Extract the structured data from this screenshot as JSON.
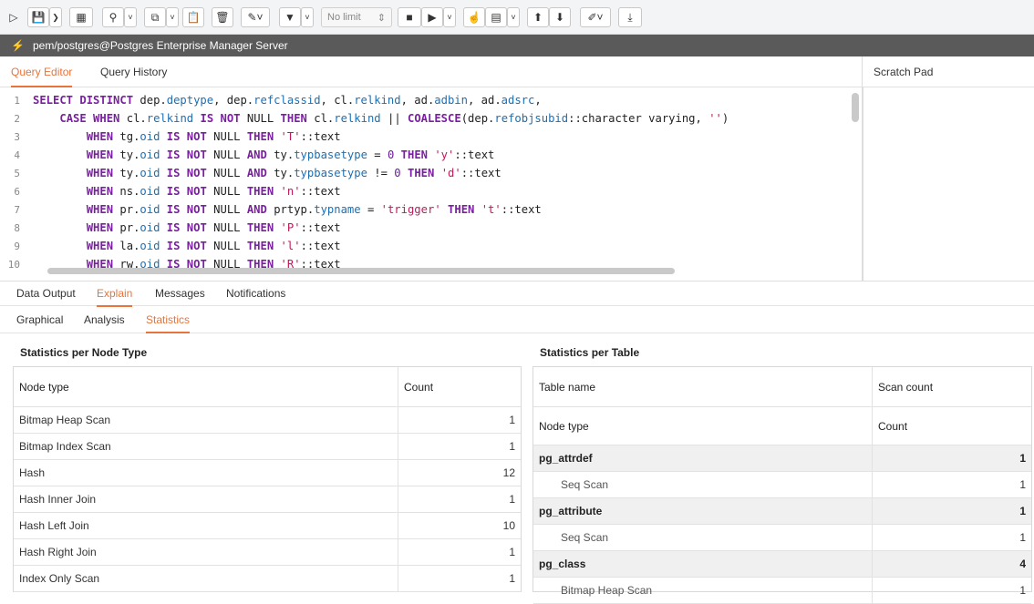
{
  "toolbar": {
    "no_limit": "No limit"
  },
  "connection": {
    "label": "pem/postgres@Postgres Enterprise Manager Server"
  },
  "editor_tabs": [
    "Query Editor",
    "Query History"
  ],
  "scratch_pad": "Scratch Pad",
  "code_lines": [
    {
      "n": "1",
      "html": "<span class=\"kw\">SELECT DISTINCT</span> dep.<span class=\"col\">deptype</span>, dep.<span class=\"col\">refclassid</span>, cl.<span class=\"col\">relkind</span>, ad.<span class=\"col\">adbin</span>, ad.<span class=\"col\">adsrc</span>,"
    },
    {
      "n": "2",
      "html": "    <span class=\"kw\">CASE WHEN</span> cl.<span class=\"col\">relkind</span> <span class=\"kw\">IS NOT</span> NULL <span class=\"kw\">THEN</span> cl.<span class=\"col\">relkind</span> || <span class=\"fn\">COALESCE</span>(dep.<span class=\"col\">refobjsubid</span>::character varying, <span class=\"str\">''</span>)"
    },
    {
      "n": "3",
      "html": "        <span class=\"kw\">WHEN</span> tg.<span class=\"col\">oid</span> <span class=\"kw\">IS NOT</span> NULL <span class=\"kw\">THEN</span> <span class=\"str\">'T'</span>::text"
    },
    {
      "n": "4",
      "html": "        <span class=\"kw\">WHEN</span> ty.<span class=\"col\">oid</span> <span class=\"kw\">IS NOT</span> NULL <span class=\"kw\">AND</span> ty.<span class=\"col\">typbasetype</span> = <span class=\"num\">0</span> <span class=\"kw\">THEN</span> <span class=\"str\">'y'</span>::text"
    },
    {
      "n": "5",
      "html": "        <span class=\"kw\">WHEN</span> ty.<span class=\"col\">oid</span> <span class=\"kw\">IS NOT</span> NULL <span class=\"kw\">AND</span> ty.<span class=\"col\">typbasetype</span> != <span class=\"num\">0</span> <span class=\"kw\">THEN</span> <span class=\"str\">'d'</span>::text"
    },
    {
      "n": "6",
      "html": "        <span class=\"kw\">WHEN</span> ns.<span class=\"col\">oid</span> <span class=\"kw\">IS NOT</span> NULL <span class=\"kw\">THEN</span> <span class=\"str\">'n'</span>::text"
    },
    {
      "n": "7",
      "html": "        <span class=\"kw\">WHEN</span> pr.<span class=\"col\">oid</span> <span class=\"kw\">IS NOT</span> NULL <span class=\"kw\">AND</span> prtyp.<span class=\"col\">typname</span> = <span class=\"str\">'trigger'</span> <span class=\"kw\">THEN</span> <span class=\"str\">'t'</span>::text"
    },
    {
      "n": "8",
      "html": "        <span class=\"kw\">WHEN</span> pr.<span class=\"col\">oid</span> <span class=\"kw\">IS NOT</span> NULL <span class=\"kw\">THEN</span> <span class=\"str\">'P'</span>::text"
    },
    {
      "n": "9",
      "html": "        <span class=\"kw\">WHEN</span> la.<span class=\"col\">oid</span> <span class=\"kw\">IS NOT</span> NULL <span class=\"kw\">THEN</span> <span class=\"str\">'l'</span>::text"
    },
    {
      "n": "10",
      "html": "        <span class=\"kw\">WHEN</span> rw.<span class=\"col\">oid</span> <span class=\"kw\">IS NOT</span> NULL <span class=\"kw\">THEN</span> <span class=\"str\">'R'</span>::text"
    }
  ],
  "result_tabs": [
    "Data Output",
    "Explain",
    "Messages",
    "Notifications"
  ],
  "explain_tabs": [
    "Graphical",
    "Analysis",
    "Statistics"
  ],
  "node_stats": {
    "title": "Statistics per Node Type",
    "headers": [
      "Node type",
      "Count"
    ],
    "rows": [
      {
        "type": "Bitmap Heap Scan",
        "count": "1"
      },
      {
        "type": "Bitmap Index Scan",
        "count": "1"
      },
      {
        "type": "Hash",
        "count": "12"
      },
      {
        "type": "Hash Inner Join",
        "count": "1"
      },
      {
        "type": "Hash Left Join",
        "count": "10"
      },
      {
        "type": "Hash Right Join",
        "count": "1"
      },
      {
        "type": "Index Only Scan",
        "count": "1"
      }
    ]
  },
  "table_stats": {
    "title": "Statistics per Table",
    "headers": [
      "Table name",
      "Scan count"
    ],
    "sub_headers": [
      "Node type",
      "Count"
    ],
    "rows": [
      {
        "kind": "group",
        "name": "pg_attrdef",
        "count": "1"
      },
      {
        "kind": "child",
        "name": "Seq Scan",
        "count": "1"
      },
      {
        "kind": "group",
        "name": "pg_attribute",
        "count": "1"
      },
      {
        "kind": "child",
        "name": "Seq Scan",
        "count": "1"
      },
      {
        "kind": "group",
        "name": "pg_class",
        "count": "4"
      },
      {
        "kind": "child",
        "name": "Bitmap Heap Scan",
        "count": "1"
      }
    ]
  }
}
